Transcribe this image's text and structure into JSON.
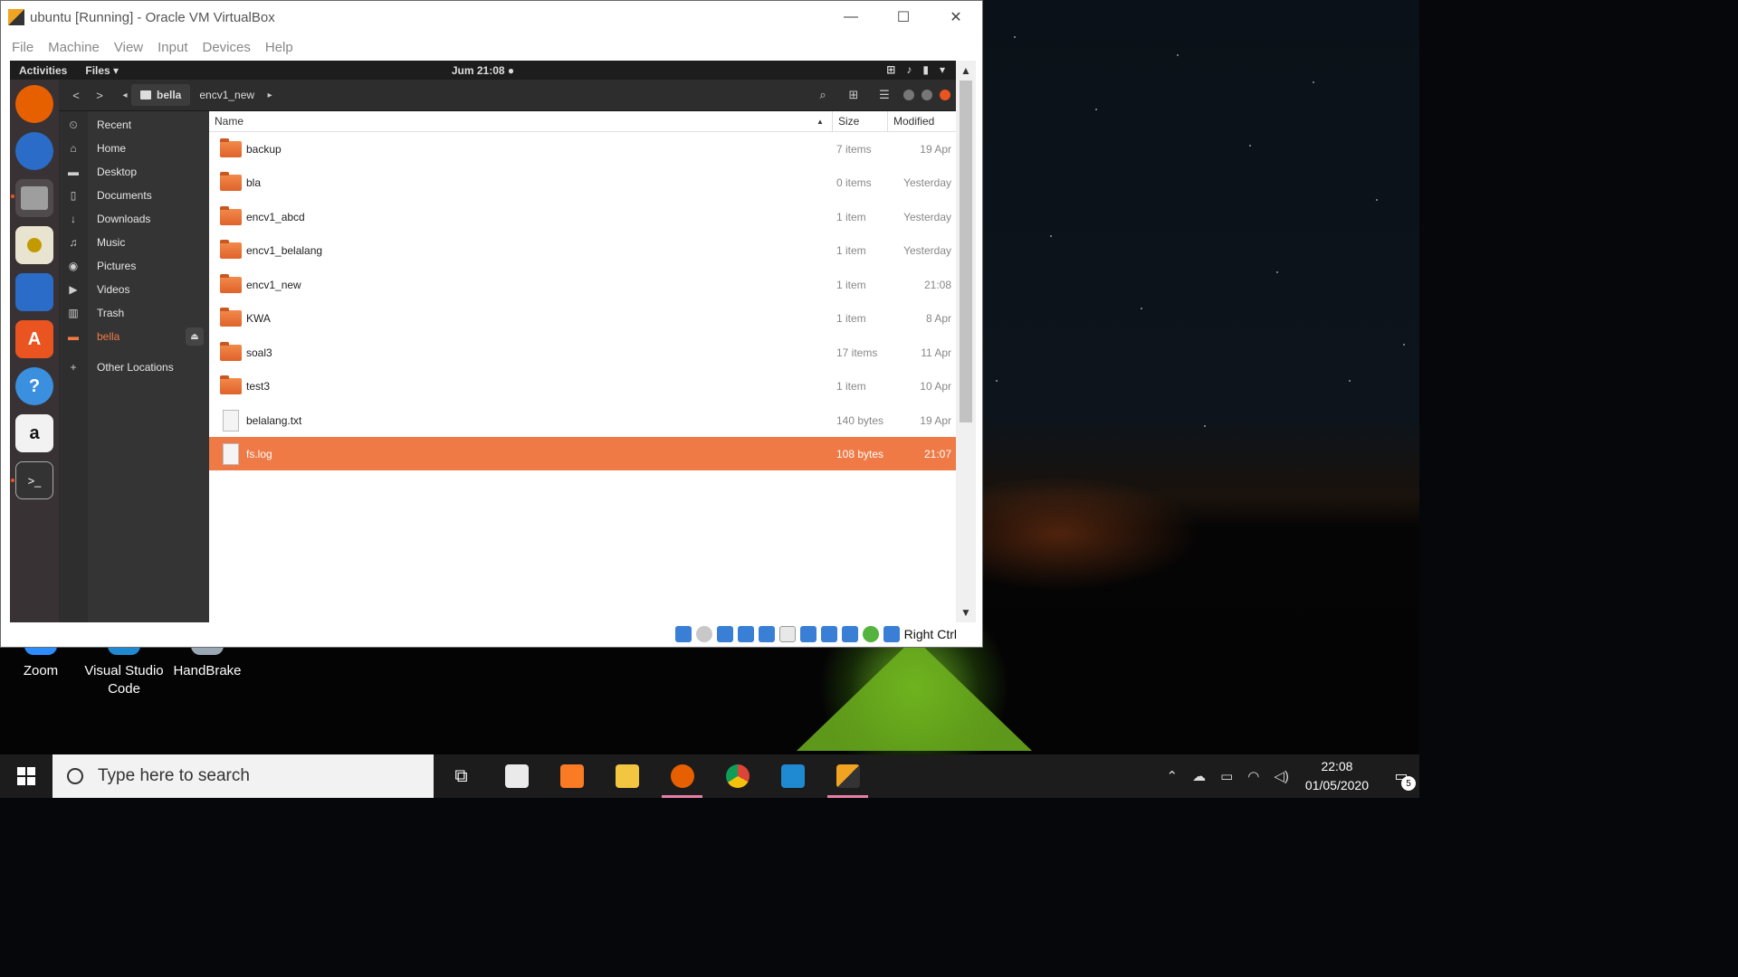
{
  "window": {
    "title": "ubuntu [Running] - Oracle VM VirtualBox",
    "menu": [
      "File",
      "Machine",
      "View",
      "Input",
      "Devices",
      "Help"
    ],
    "status_host_key": "Right Ctrl"
  },
  "guest": {
    "topbar": {
      "activities": "Activities",
      "app_menu": "Files ▾",
      "clock": "Jum 21:08 ●"
    },
    "dock": [
      "firefox-icon",
      "thunderbird-icon",
      "files-icon",
      "rhythmbox-icon",
      "libreoffice-writer-icon",
      "ubuntu-software-icon",
      "help-icon",
      "amazon-icon",
      "terminal-icon"
    ],
    "files": {
      "path": [
        "bella",
        "encv1_new"
      ],
      "sidebar": [
        {
          "label": "Recent",
          "icon": "⏲"
        },
        {
          "label": "Home",
          "icon": "⌂"
        },
        {
          "label": "Desktop",
          "icon": "▬"
        },
        {
          "label": "Documents",
          "icon": "▯"
        },
        {
          "label": "Downloads",
          "icon": "↓"
        },
        {
          "label": "Music",
          "icon": "♫"
        },
        {
          "label": "Pictures",
          "icon": "◉"
        },
        {
          "label": "Videos",
          "icon": "▶"
        },
        {
          "label": "Trash",
          "icon": "▥"
        },
        {
          "label": "bella",
          "icon": "▬"
        },
        {
          "label": "Other Locations",
          "icon": "+"
        }
      ],
      "columns": {
        "name": "Name",
        "size": "Size",
        "modified": "Modified"
      },
      "rows": [
        {
          "name": "backup",
          "size": "7 items",
          "modified": "19 Apr",
          "type": "folder"
        },
        {
          "name": "bla",
          "size": "0 items",
          "modified": "Yesterday",
          "type": "folder"
        },
        {
          "name": "encv1_abcd",
          "size": "1 item",
          "modified": "Yesterday",
          "type": "folder"
        },
        {
          "name": "encv1_belalang",
          "size": "1 item",
          "modified": "Yesterday",
          "type": "folder"
        },
        {
          "name": "encv1_new",
          "size": "1 item",
          "modified": "21:08",
          "type": "folder"
        },
        {
          "name": "KWA",
          "size": "1 item",
          "modified": "8 Apr",
          "type": "folder"
        },
        {
          "name": "soal3",
          "size": "17 items",
          "modified": "11 Apr",
          "type": "folder"
        },
        {
          "name": "test3",
          "size": "1 item",
          "modified": "10 Apr",
          "type": "folder"
        },
        {
          "name": "belalang.txt",
          "size": "140 bytes",
          "modified": "19 Apr",
          "type": "file"
        },
        {
          "name": "fs.log",
          "size": "108 bytes",
          "modified": "21:07",
          "type": "file",
          "selected": true
        }
      ]
    }
  },
  "desktop_icons": [
    {
      "label": "Zoom"
    },
    {
      "label": "Visual Studio Code"
    },
    {
      "label": "HandBrake"
    }
  ],
  "taskbar": {
    "search_placeholder": "Type here to search",
    "time": "22:08",
    "date": "01/05/2020",
    "notification_count": "5"
  },
  "colors": {
    "accent": "#f07a46",
    "dock": "#393235",
    "taskbar": "#1c1c1c"
  }
}
